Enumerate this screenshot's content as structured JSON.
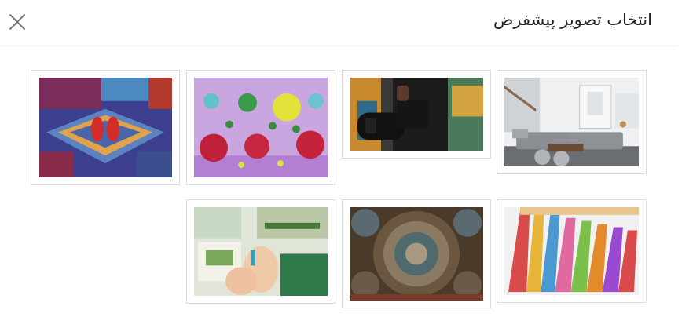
{
  "dialog": {
    "title": "انتخاب تصویر پیشفرض",
    "close_icon": "close-icon"
  },
  "gallery": {
    "images": [
      {
        "id": "living-room",
        "subject": "living-room-photo"
      },
      {
        "id": "camera",
        "subject": "camera-photo"
      },
      {
        "id": "flowers",
        "subject": "floral-fabric-photo"
      },
      {
        "id": "shoes-carpet",
        "subject": "shoes-on-carpet-photo"
      },
      {
        "id": "slippers",
        "subject": "colorful-slippers-photo"
      },
      {
        "id": "ceiling",
        "subject": "mosque-ceiling-photo"
      },
      {
        "id": "crafts",
        "subject": "paper-crafting-photo"
      }
    ]
  }
}
